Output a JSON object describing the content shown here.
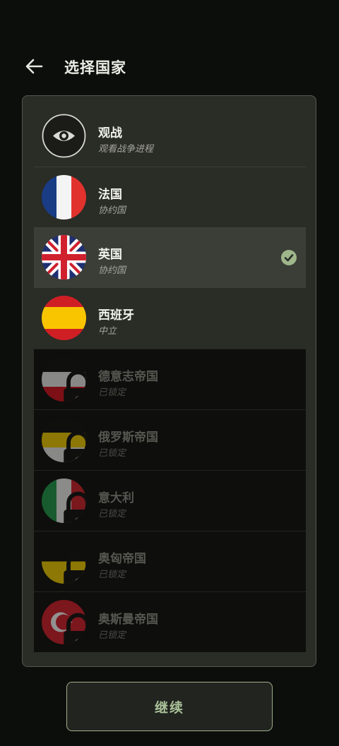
{
  "header": {
    "title": "选择国家",
    "back_icon": "arrow-left-icon"
  },
  "countries": [
    {
      "name": "观战",
      "subtitle": "观看战争进程",
      "icon": "eye-icon",
      "locked": false,
      "selected": false
    },
    {
      "name": "法国",
      "subtitle": "协约国",
      "icon": "france-flag-icon",
      "locked": false,
      "selected": false
    },
    {
      "name": "英国",
      "subtitle": "协约国",
      "icon": "uk-flag-icon",
      "locked": false,
      "selected": true
    },
    {
      "name": "西班牙",
      "subtitle": "中立",
      "icon": "spain-flag-icon",
      "locked": false,
      "selected": false
    },
    {
      "name": "德意志帝国",
      "subtitle": "已锁定",
      "icon": "german-empire-flag-icon",
      "locked": true,
      "selected": false
    },
    {
      "name": "俄罗斯帝国",
      "subtitle": "已锁定",
      "icon": "russian-empire-flag-icon",
      "locked": true,
      "selected": false
    },
    {
      "name": "意大利",
      "subtitle": "已锁定",
      "icon": "italy-flag-icon",
      "locked": true,
      "selected": false
    },
    {
      "name": "奥匈帝国",
      "subtitle": "已锁定",
      "icon": "austria-hungary-flag-icon",
      "locked": true,
      "selected": false
    },
    {
      "name": "奥斯曼帝国",
      "subtitle": "已锁定",
      "icon": "ottoman-flag-icon",
      "locked": true,
      "selected": false
    }
  ],
  "footer": {
    "continue_label": "继续"
  },
  "colors": {
    "background": "#0c0e0b",
    "panel": "#2a2c26",
    "selected_row": "#3b3d37",
    "accent": "#9eb68a"
  }
}
